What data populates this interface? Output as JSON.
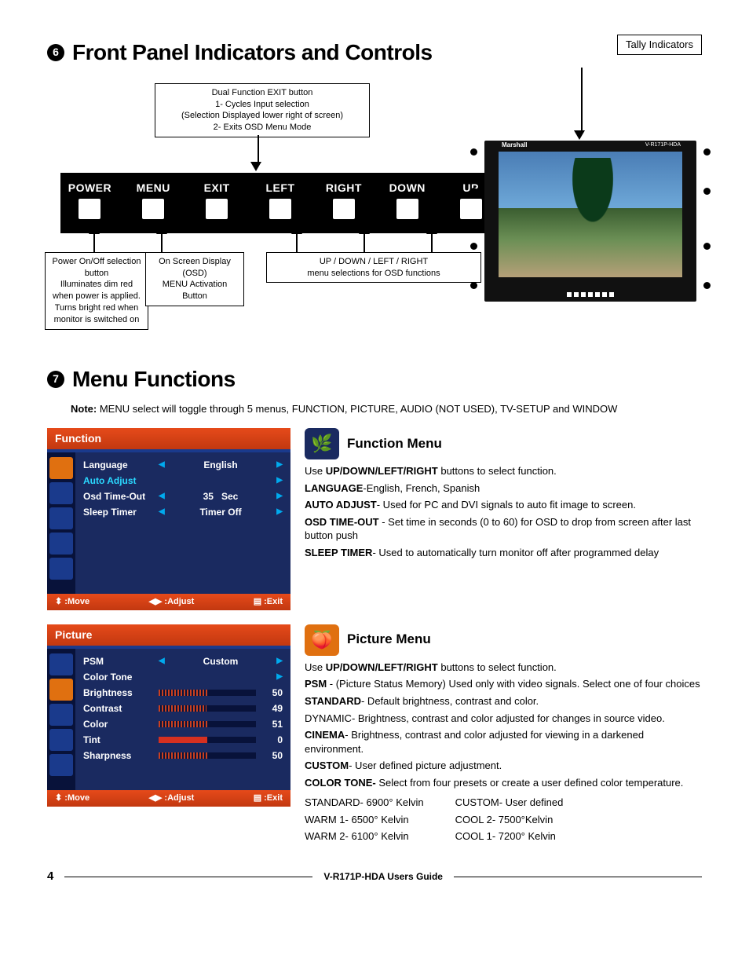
{
  "section6": {
    "num": "6",
    "title": "Front Panel Indicators and Controls",
    "tally_label": "Tally Indicators",
    "exit_callout": "Dual Function EXIT button\n1- Cycles Input selection\n(Selection Displayed lower right of screen)\n2- Exits OSD Menu Mode",
    "buttons": [
      "POWER",
      "MENU",
      "EXIT",
      "LEFT",
      "RIGHT",
      "DOWN",
      "UP"
    ],
    "power_callout": "Power On/Off selection button\nIlluminates dim red when power is applied.\nTurns bright red when monitor is switched on",
    "menu_callout": "On Screen Display (OSD)\nMENU Activation Button",
    "nav_callout": "UP / DOWN / LEFT / RIGHT\nmenu selections for OSD functions",
    "monitor_brand": "Marshall",
    "monitor_model": "V-R171P-HDA"
  },
  "section7": {
    "num": "7",
    "title": "Menu Functions",
    "note_prefix": "Note:",
    "note_text": " MENU select will toggle through 5 menus, FUNCTION, PICTURE, AUDIO (NOT USED), TV-SETUP and WINDOW"
  },
  "function_osd": {
    "head": "Function",
    "rows": {
      "language": {
        "label": "Language",
        "value": "English"
      },
      "auto": {
        "label": "Auto Adjust"
      },
      "timeout": {
        "label": "Osd Time-Out",
        "value": "35",
        "unit": "Sec"
      },
      "sleep": {
        "label": "Sleep Timer",
        "value": "Timer Off"
      }
    },
    "foot_move": ":Move",
    "foot_adjust": ":Adjust",
    "foot_exit": ":Exit"
  },
  "function_desc": {
    "title": "Function Menu",
    "intro_a": "Use ",
    "intro_b": "UP/DOWN/LEFT/RIGHT",
    "intro_c": " buttons to select function.",
    "lang_b": "LANGUAGE",
    "lang_t": "-English, French, Spanish",
    "auto_b": "AUTO ADJUST",
    "auto_t": "- Used for PC and DVI signals to auto fit image to screen.",
    "osd_b": "OSD TIME-OUT",
    "osd_t": " - Set time in seconds (0 to 60) for OSD to drop from screen after last button push",
    "sleep_b": "SLEEP TIMER",
    "sleep_t": "- Used to automatically turn monitor off after programmed delay"
  },
  "picture_osd": {
    "head": "Picture",
    "psm": {
      "label": "PSM",
      "value": "Custom"
    },
    "colortone": {
      "label": "Color Tone"
    },
    "brightness": {
      "label": "Brightness",
      "value": "50"
    },
    "contrast": {
      "label": "Contrast",
      "value": "49"
    },
    "color": {
      "label": "Color",
      "value": "51"
    },
    "tint": {
      "label": "Tint",
      "value": "0"
    },
    "sharpness": {
      "label": "Sharpness",
      "value": "50"
    }
  },
  "picture_desc": {
    "title": "Picture Menu",
    "intro_a": "Use ",
    "intro_b": "UP/DOWN/LEFT/RIGHT",
    "intro_c": " buttons to select function.",
    "psm_b": "PSM",
    "psm_t": " - (Picture Status Memory) Used only with video signals. Select one of four choices",
    "std_b": "STANDARD",
    "std_t": "- Default brightness, contrast and color.",
    "dyn_t": "DYNAMIC- Brightness, contrast and color adjusted for changes in source video.",
    "cin_b": "CINEMA",
    "cin_t": "- Brightness, contrast and color adjusted for viewing in a darkened environment.",
    "cus_b": "CUSTOM",
    "cus_t": "- User defined picture adjustment.",
    "ct_b": "COLOR TONE-",
    "ct_t": " Select from four presets or create a user defined color temperature.",
    "k_std": "STANDARD- 6900° Kelvin",
    "k_w1": "WARM 1- 6500° Kelvin",
    "k_w2": "WARM 2- 6100° Kelvin",
    "k_cust": "CUSTOM- User defined",
    "k_c2": "COOL 2-  7500°Kelvin",
    "k_c1": "COOL 1-  7200° Kelvin"
  },
  "footer": {
    "page": "4",
    "guide": "V-R171P-HDA Users Guide"
  }
}
